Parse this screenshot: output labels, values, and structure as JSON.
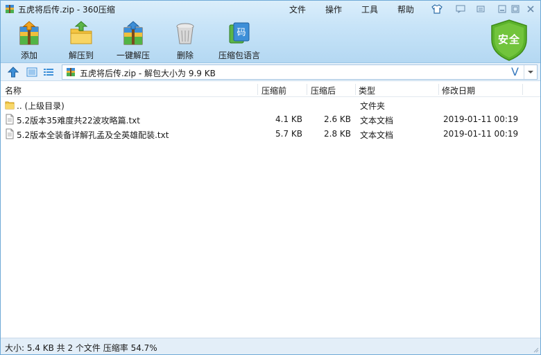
{
  "window": {
    "title": "五虎将后传.zip - 360压缩"
  },
  "menu": {
    "file": "文件",
    "operation": "操作",
    "tools": "工具",
    "help": "帮助"
  },
  "toolbar": {
    "add": "添加",
    "extract_to": "解压到",
    "one_key_extract": "一键解压",
    "delete": "删除",
    "codepage": "压缩包语言",
    "codepage_icon_char": "码"
  },
  "security_badge": "安全",
  "address": {
    "path": "五虎将后传.zip - 解包大小为 9.9 KB",
    "v_mark": "V"
  },
  "columns": {
    "name": "名称",
    "compressed_before": "压缩前",
    "compressed_after": "压缩后",
    "type": "类型",
    "modified": "修改日期"
  },
  "files": [
    {
      "name": ".. (上级目录)",
      "before": "",
      "after": "",
      "type": "文件夹",
      "date": "",
      "icon": "folder-icon"
    },
    {
      "name": "5.2版本35难度共22波攻略篇.txt",
      "before": "4.1 KB",
      "after": "2.6 KB",
      "type": "文本文档",
      "date": "2019-01-11 00:19",
      "icon": "text-file-icon"
    },
    {
      "name": "5.2版本全装备详解孔孟及全英雄配装.txt",
      "before": "5.7 KB",
      "after": "2.8 KB",
      "type": "文本文档",
      "date": "2019-01-11 00:19",
      "icon": "text-file-icon"
    }
  ],
  "status": "大小: 5.4 KB 共 2 个文件 压缩率 54.7%",
  "colors": {
    "header_top": "#dbeefb",
    "header_bottom": "#b4d8f2",
    "accent_blue": "#3a7bbf",
    "shield_green": "#5cb32c"
  }
}
